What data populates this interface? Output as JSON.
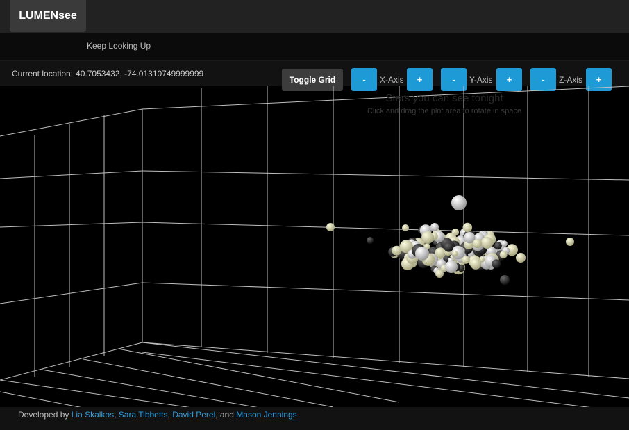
{
  "app": {
    "brand": "LUMENsee",
    "tagline": "Keep Looking Up"
  },
  "location": {
    "label": "Current location:",
    "coords": "40.7053432, -74.01310749999999"
  },
  "controls": {
    "toggle_grid": "Toggle Grid",
    "minus": "-",
    "plus": "+",
    "x_axis": "X-Axis",
    "y_axis": "Y-Axis",
    "z_axis": "Z-Axis"
  },
  "plot": {
    "title": "Stars you can see tonight",
    "subtitle": "Click and drag the plot area to rotate in space"
  },
  "footer": {
    "prefix": "Developed by",
    "authors": [
      "Lia Skalkos",
      "Sara Tibbetts",
      "David Perel",
      "Mason Jennings"
    ],
    "sep1": ",",
    "sep2": ",",
    "conj": ", and"
  },
  "colors": {
    "accent": "#1e9bd7",
    "link": "#2a9fe0",
    "star_white": "#f2f2f2",
    "star_yellow": "#ecebc0",
    "star_dark": "#333333"
  }
}
